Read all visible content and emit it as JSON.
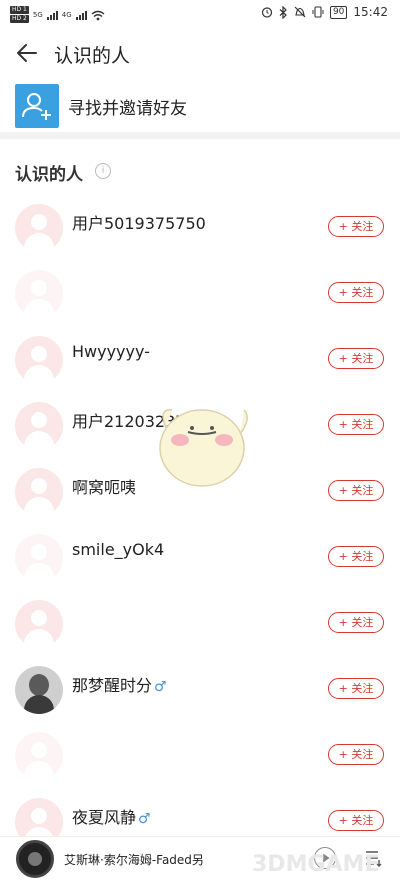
{
  "status_bar": {
    "sim1": "HD 1",
    "sim2": "HD 2",
    "network1": "5G",
    "network2": "4G",
    "battery": "90",
    "time": "15:42"
  },
  "header": {
    "back_icon": "arrow-left-icon",
    "title": "认识的人"
  },
  "invite": {
    "icon": "add-person-icon",
    "label": "寻找并邀请好友"
  },
  "section": {
    "title": "认识的人",
    "info_icon": "i"
  },
  "follow_label": "+ 关注",
  "users": [
    {
      "name": "用户5019375750",
      "gender": ""
    },
    {
      "name": "",
      "gender": ""
    },
    {
      "name": "Hwyyyyy-",
      "gender": ""
    },
    {
      "name": "用户2120323705",
      "gender": ""
    },
    {
      "name": "啊窝呃咦",
      "gender": ""
    },
    {
      "name": "smile_yOk4",
      "gender": ""
    },
    {
      "name": "",
      "gender": ""
    },
    {
      "name": "那梦醒时分",
      "gender": "♂"
    },
    {
      "name": "",
      "gender": ""
    },
    {
      "name": "夜夏风静",
      "gender": "♂"
    }
  ],
  "player": {
    "title": "艾斯琳·索尔海姆-Faded另"
  },
  "watermark": {
    "text": "3DMGAME"
  },
  "colors": {
    "accent_red": "#d33a31",
    "invite_blue": "#3aa0e0",
    "male_blue": "#4a90e2"
  }
}
